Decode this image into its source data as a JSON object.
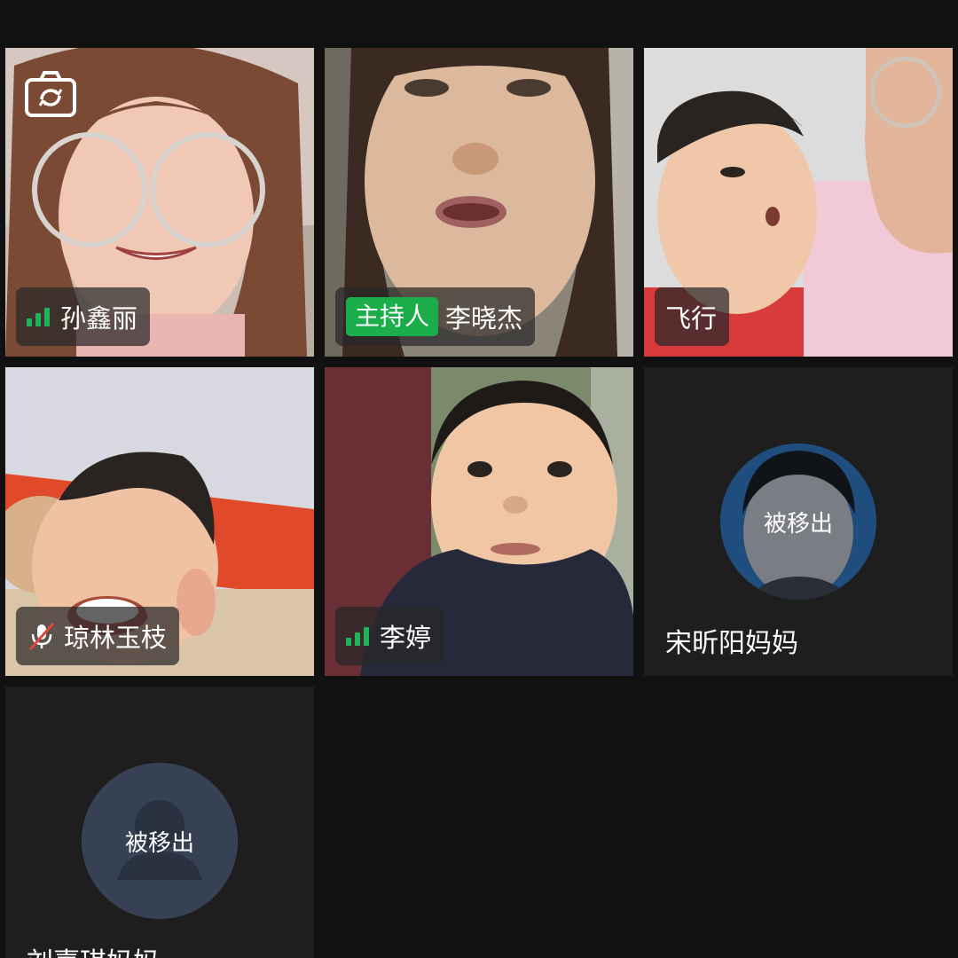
{
  "participants": [
    {
      "name": "孙鑫丽",
      "signal_icon": "signal-bars-icon"
    },
    {
      "host_badge": "主持人",
      "name": "李晓杰"
    },
    {
      "name": "飞行"
    },
    {
      "name": "琼林玉枝",
      "status_icon": "mic-muted-icon"
    },
    {
      "name": "李婷",
      "signal_icon": "signal-bars-icon"
    },
    {
      "name": "宋昕阳妈妈",
      "status": "被移出"
    },
    {
      "name": "刘嘉琪妈妈",
      "status": "被移出"
    }
  ],
  "colors": {
    "background": "#111111",
    "host_badge": "#1aad4a",
    "signal": "#1fb35a",
    "muted_slash": "#e0463a"
  },
  "icons": {
    "camera_switch": "camera-switch-icon"
  }
}
